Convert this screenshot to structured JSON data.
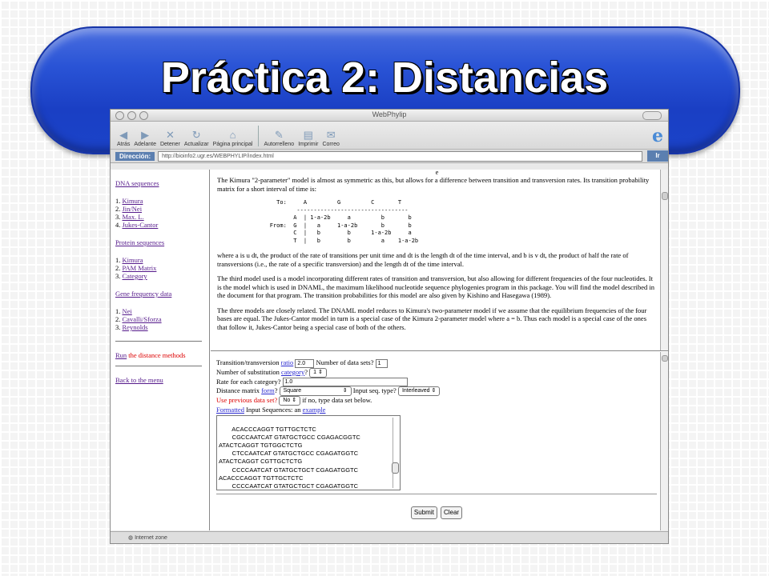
{
  "slide": {
    "title": "Práctica 2: Distancias"
  },
  "browser": {
    "window_title": "WebPhylip",
    "toolbar": [
      {
        "label": "Atrás",
        "icon": "back-arrow-icon"
      },
      {
        "label": "Adelante",
        "icon": "forward-arrow-icon"
      },
      {
        "label": "Detener",
        "icon": "stop-x-icon"
      },
      {
        "label": "Actualizar",
        "icon": "refresh-icon"
      },
      {
        "label": "Página principal",
        "icon": "home-icon"
      },
      {
        "label": "Autorrelleno",
        "icon": "autofill-icon"
      },
      {
        "label": "Imprimir",
        "icon": "print-icon"
      },
      {
        "label": "Correo",
        "icon": "mail-icon"
      }
    ],
    "address_label": "Dirección:",
    "url": "http://bioinfo2.ugr.es/WEBPHYLIP/index.html",
    "go_label": "Ir",
    "status": "Internet zone"
  },
  "left_frame": {
    "dna": {
      "heading": "DNA sequences",
      "items": [
        "Kimura",
        "Jin/Nei",
        "Max. L.",
        "Jukes-Cantor"
      ]
    },
    "protein": {
      "heading": "Protein sequences",
      "items": [
        "Kimura",
        "PAM Matrix",
        "Category"
      ]
    },
    "gene": {
      "heading": "Gene frequency data",
      "items": [
        "Nei",
        "Cavalli/Sforza",
        "Reynolds"
      ]
    },
    "run_link": "Run",
    "run_text": " the distance methods",
    "back_link": "Back to the menu"
  },
  "top_frame": {
    "top_char": "e",
    "para1": "The Kimura \"2-parameter\" model is almost as symmetric as this, but allows for a difference between transition and transversion rates. Its transition probability matrix for a short interval of time is:",
    "matrix": "          To:     A         G         C       T\n                ---------------------------------\n               A  | 1-a-2b     a         b       b\n        From:  G  |   a     1-a-2b       b       b\n               C  |   b        b      1-a-2b     a\n               T  |   b        b         a    1-a-2b",
    "para2": "where a is u dt, the product of the rate of transitions per unit time and dt is the length dt of the time interval, and b is v dt, the product of half the rate of transversions (i.e., the rate of a specific transversion) and the length dt of the time interval.",
    "para3": "The third model used is a model incorporating different rates of transition and transversion, but also allowing for different frequencies of the four nucleotides. It is the model which is used in DNAML, the maximum likelihood nucleotide sequence phylogenies program in this package. You will find the model described in the document for that program. The transition probabilities for this model are also given by Kishino and Hasegawa (1989).",
    "para4": "The three models are closely related. The DNAML model reduces to Kimura's two-parameter model if we assume that the equilibrium frequencies of the four bases are equal. The Jukes-Cantor model in turn is a special case of the Kimura 2-parameter model where a = b. Thus each model is a special case of the ones that follow it, Jukes-Cantor being a special case of both of the others."
  },
  "form": {
    "ratio_pre": "Transition/transversion ",
    "ratio_link": "ratio",
    "ratio_value": "2.0",
    "datasets_label": "Number of data sets?",
    "datasets_value": "1",
    "subst_pre": "Number of substitution ",
    "subst_link": "category",
    "subst_value": "1",
    "rate_label": "Rate for each category?",
    "rate_value": "1.0",
    "matrix_pre": "Distance matrix ",
    "matrix_link": "form",
    "matrix_value": "Square",
    "seqtype_label": "Input seq. type?",
    "seqtype_value": "Interleaved",
    "prev_label": "Use previous data set?",
    "prev_value": "No",
    "prev_hint": "if no, type data set below.",
    "formatted_link": "Formatted",
    "input_label": " Input Sequences: an ",
    "example_link": "example",
    "sequences": "ACACCCAGGT TGTTGCTCTC\n        CGCCAATCAT GTATGCTGCC CGAGACGGTC\nATACTCAGGT TGTGGCTCTG\n        CTCCAATCAT GTATGCTGCC CGAGATGGTC\nATACTCAGGT CGTTGCTCTG\n        CCCCAATCAT GTATGCTGCT CGAGATGGTC\nACACCCAGGT TGTTGCTCTC\n        CCCCAATCAT GTATGCTGCT CGAGATGGTC\nACACCCAGGT TGTTGCTCTC",
    "submit_label": "Submit",
    "clear_label": "Clear"
  }
}
